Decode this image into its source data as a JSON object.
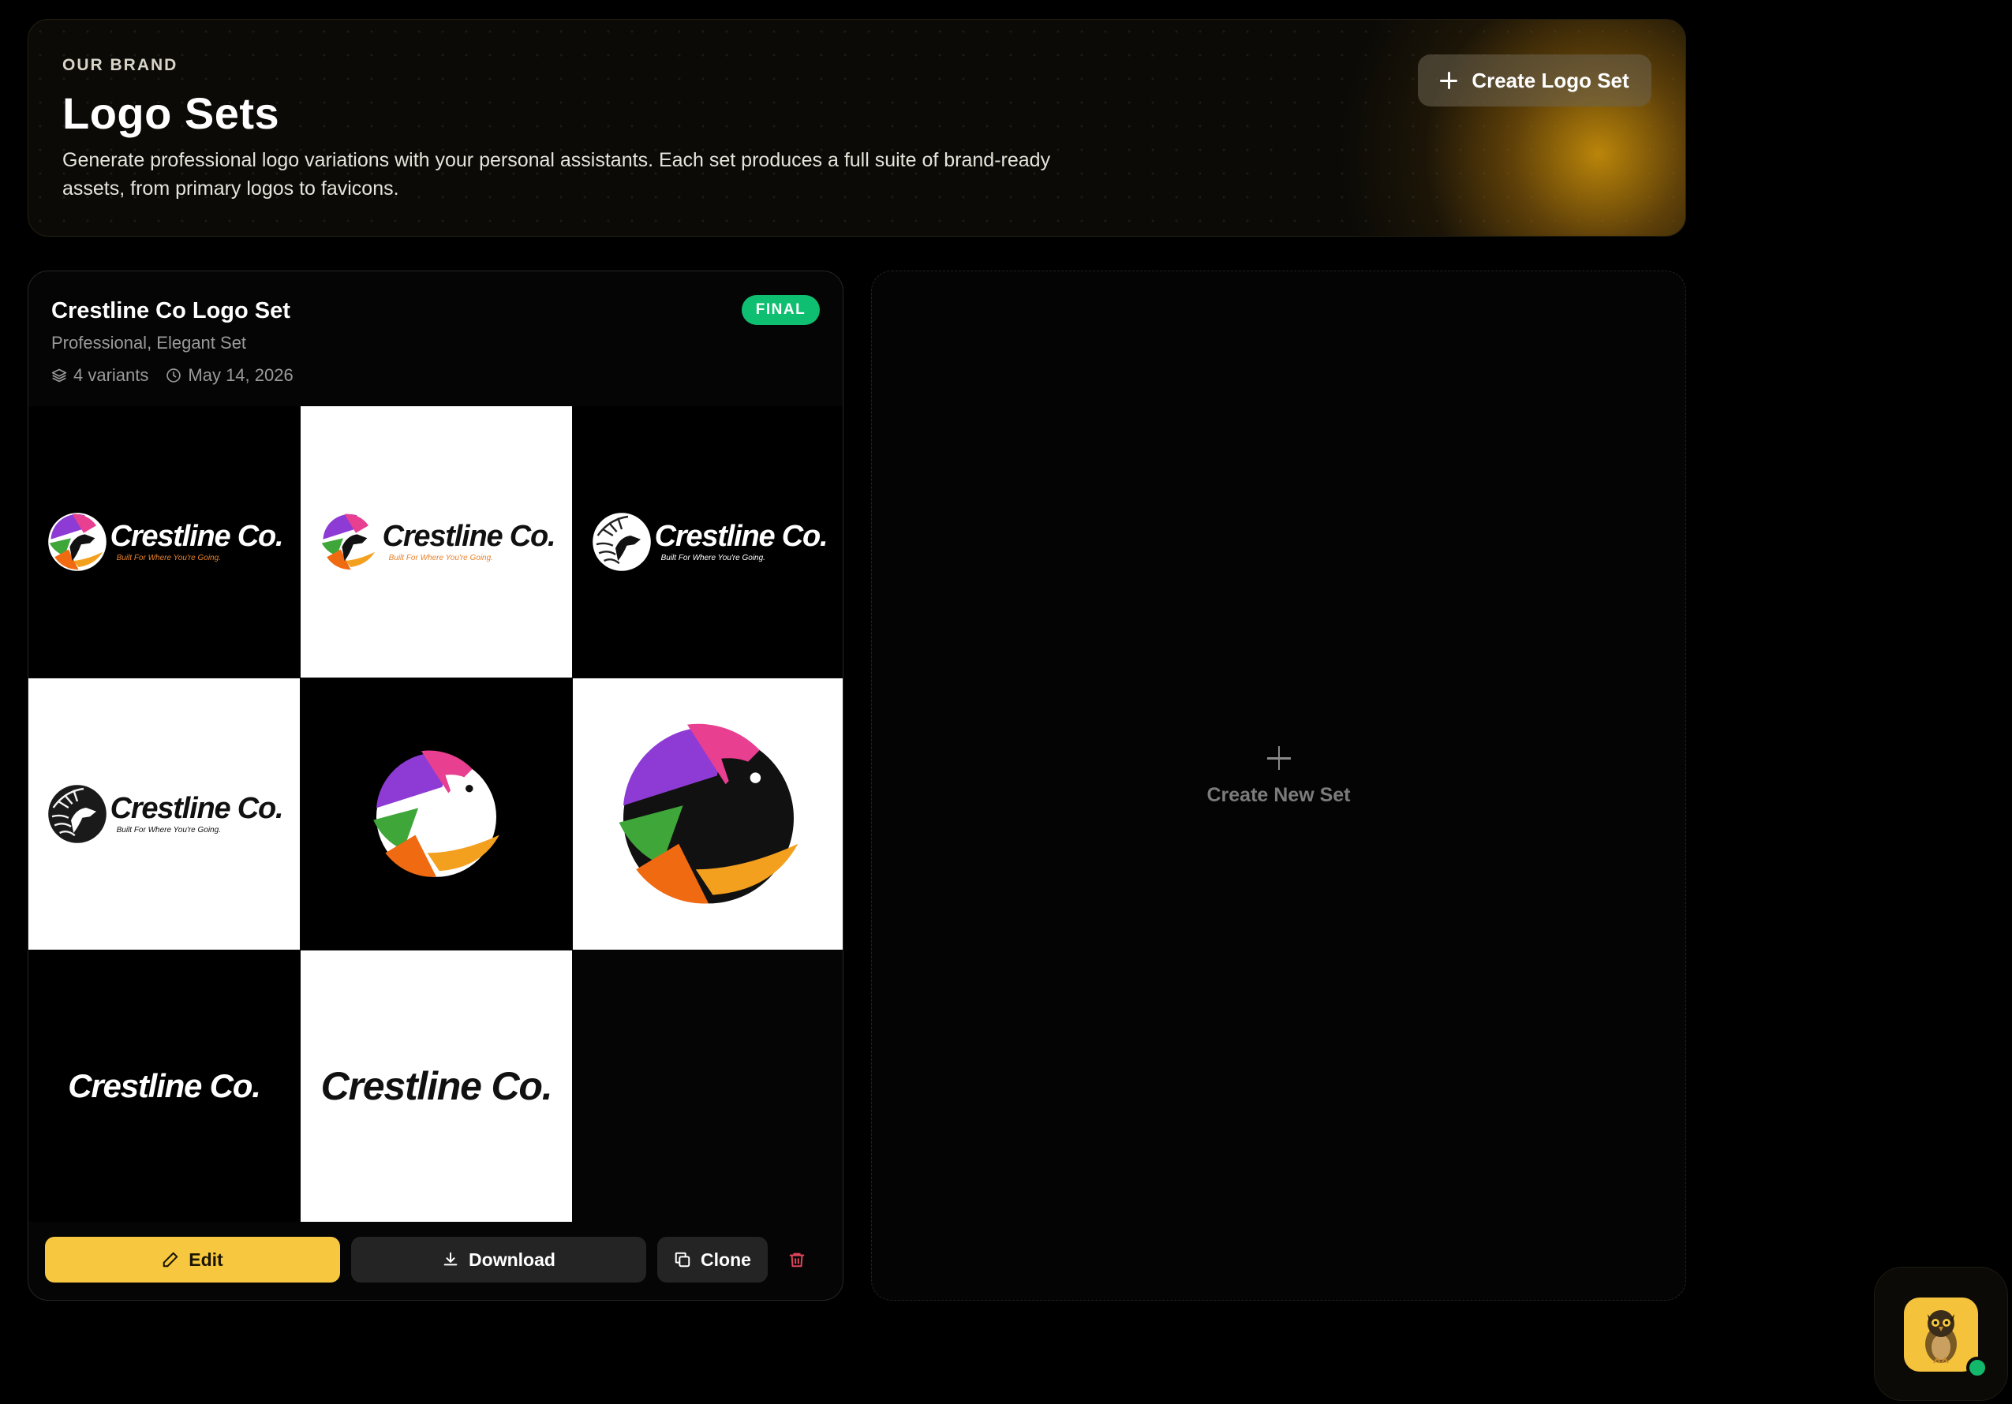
{
  "header": {
    "eyebrow": "OUR BRAND",
    "title": "Logo Sets",
    "description": "Generate professional logo variations with your personal assistants. Each set produces a full suite of brand-ready assets, from primary logos to favicons.",
    "create_button_label": "Create Logo Set"
  },
  "card": {
    "title": "Crestline Co Logo Set",
    "subtitle": "Professional, Elegant Set",
    "variants": "4 variants",
    "date": "May 14, 2026",
    "status_badge": "FINAL",
    "logo_wordmark": "Crestline Co.",
    "logo_tagline": "Built For Where You're Going.",
    "actions": {
      "edit": "Edit",
      "download": "Download",
      "clone": "Clone"
    }
  },
  "new_set": {
    "label": "Create New Set"
  },
  "colors": {
    "accent": "#f7c83f",
    "badge_green": "#0fbf71",
    "tagline_orange": "#e8822b",
    "delete_red": "#e0445a"
  }
}
